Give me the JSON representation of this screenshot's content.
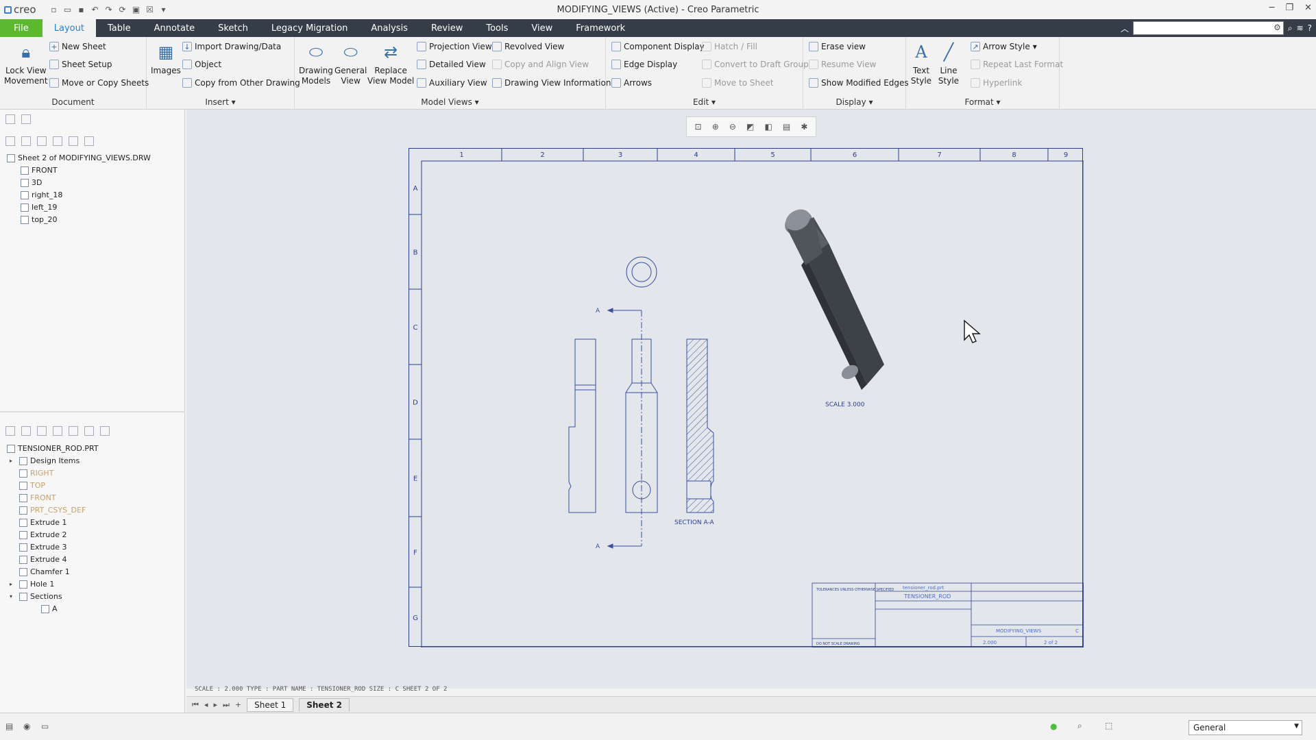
{
  "app": {
    "brand": "creo",
    "title": "MODIFYING_VIEWS (Active) - Creo Parametric"
  },
  "window_controls": {
    "minimize": "─",
    "restore": "❐",
    "close": "✕"
  },
  "tabs": [
    "File",
    "Layout",
    "Table",
    "Annotate",
    "Sketch",
    "Legacy Migration",
    "Analysis",
    "Review",
    "Tools",
    "View",
    "Framework"
  ],
  "ribbon": {
    "document": {
      "label": "Document",
      "lock": "Lock View\nMovement",
      "new_sheet": "New Sheet",
      "sheet_setup": "Sheet Setup",
      "move_copy": "Move or Copy Sheets"
    },
    "insert": {
      "label": "Insert ▾",
      "images": "Images",
      "import": "Import Drawing/Data",
      "object": "Object",
      "copy_other": "Copy from Other Drawing"
    },
    "model_views": {
      "label": "Model Views ▾",
      "drawing_models": "Drawing\nModels",
      "general_view": "General\nView",
      "replace": "Replace\nView Model",
      "projection": "Projection View",
      "detailed": "Detailed View",
      "auxiliary": "Auxiliary View",
      "revolved": "Revolved View",
      "copy_align": "Copy and Align View",
      "drawing_info": "Drawing View Information"
    },
    "edit": {
      "label": "Edit ▾",
      "component_display": "Component Display",
      "edge_display": "Edge Display",
      "arrows": "Arrows",
      "hatch": "Hatch / Fill",
      "convert": "Convert to Draft Group",
      "move_sheet": "Move to Sheet"
    },
    "display": {
      "label": "Display ▾",
      "erase": "Erase view",
      "resume": "Resume View",
      "show_modified": "Show Modified Edges"
    },
    "format": {
      "label": "Format ▾",
      "text_style": "Text\nStyle",
      "line_style": "Line\nStyle",
      "arrow_style": "Arrow Style",
      "repeat": "Repeat Last Format",
      "hyperlink": "Hyperlink"
    }
  },
  "drawing_tree": {
    "root": "Sheet 2 of MODIFYING_VIEWS.DRW",
    "items": [
      "FRONT",
      "3D",
      "right_18",
      "left_19",
      "top_20"
    ]
  },
  "model_tree": {
    "root": "TENSIONER_ROD.PRT",
    "items": [
      {
        "label": "Design Items",
        "dim": false,
        "expander": "▸"
      },
      {
        "label": "RIGHT",
        "dim": true,
        "expander": ""
      },
      {
        "label": "TOP",
        "dim": true,
        "expander": ""
      },
      {
        "label": "FRONT",
        "dim": true,
        "expander": ""
      },
      {
        "label": "PRT_CSYS_DEF",
        "dim": true,
        "expander": ""
      },
      {
        "label": "Extrude 1",
        "dim": false,
        "expander": ""
      },
      {
        "label": "Extrude 2",
        "dim": false,
        "expander": ""
      },
      {
        "label": "Extrude 3",
        "dim": false,
        "expander": ""
      },
      {
        "label": "Extrude 4",
        "dim": false,
        "expander": ""
      },
      {
        "label": "Chamfer 1",
        "dim": false,
        "expander": ""
      },
      {
        "label": "Hole 1",
        "dim": false,
        "expander": "▸"
      },
      {
        "label": "Sections",
        "dim": false,
        "expander": "▾"
      },
      {
        "label": "A",
        "dim": false,
        "expander": ""
      }
    ]
  },
  "drawing": {
    "columns": [
      "1",
      "2",
      "3",
      "4",
      "5",
      "6",
      "7",
      "8",
      "9"
    ],
    "rows": [
      "A",
      "B",
      "C",
      "D",
      "E",
      "F",
      "G"
    ],
    "section_label": "SECTION  A-A",
    "scale_label": "SCALE  3.000",
    "cut_label": "A",
    "title_block": {
      "desc": "tensioner_rod.prt",
      "part": "TENSIONER_ROD",
      "drawing": "MODIFYING_VIEWS",
      "scale": "2.000",
      "sheet": "2 of 2",
      "size": "C",
      "dns": "DO NOT SCALE DRAWING",
      "tol": "TOLERANCES UNLESS\nOTHERWISE SPECIFIED"
    }
  },
  "status_line": "SCALE : 2.000    TYPE : PART    NAME : TENSIONER_ROD    SIZE : C    SHEET 2  OF 2",
  "sheet_tabs": [
    "Sheet 1",
    "Sheet 2"
  ],
  "filter": {
    "value": "General"
  }
}
